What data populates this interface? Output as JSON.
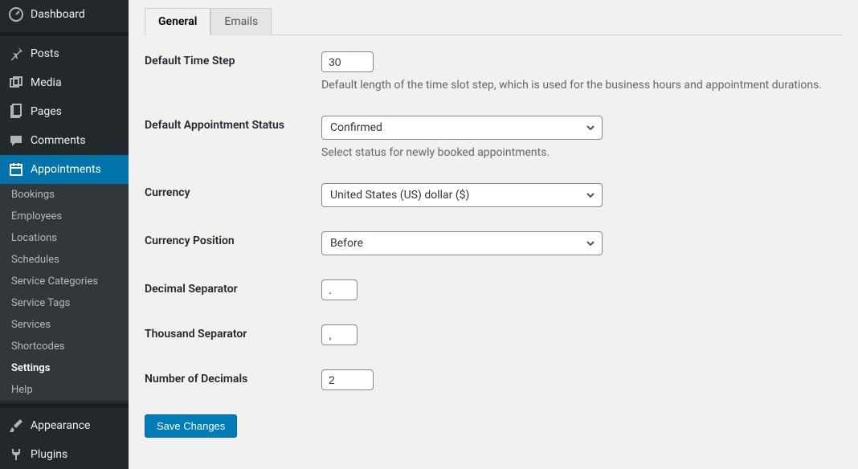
{
  "sidebar": {
    "dashboard": "Dashboard",
    "posts": "Posts",
    "media": "Media",
    "pages": "Pages",
    "comments": "Comments",
    "appointments": "Appointments",
    "appearance": "Appearance",
    "plugins": "Plugins",
    "sub": {
      "bookings": "Bookings",
      "employees": "Employees",
      "locations": "Locations",
      "schedules": "Schedules",
      "service_categories": "Service Categories",
      "service_tags": "Service Tags",
      "services": "Services",
      "shortcodes": "Shortcodes",
      "settings": "Settings",
      "help": "Help"
    }
  },
  "tabs": {
    "general": "General",
    "emails": "Emails"
  },
  "fields": {
    "default_time_step": {
      "label": "Default Time Step",
      "value": "30",
      "help": "Default length of the time slot step, which is used for the business hours and appointment durations."
    },
    "default_appointment_status": {
      "label": "Default Appointment Status",
      "value": "Confirmed",
      "help": "Select status for newly booked appointments."
    },
    "currency": {
      "label": "Currency",
      "value": "United States (US) dollar ($)"
    },
    "currency_position": {
      "label": "Currency Position",
      "value": "Before"
    },
    "decimal_separator": {
      "label": "Decimal Separator",
      "value": "."
    },
    "thousand_separator": {
      "label": "Thousand Separator",
      "value": ","
    },
    "number_of_decimals": {
      "label": "Number of Decimals",
      "value": "2"
    }
  },
  "save_label": "Save Changes"
}
